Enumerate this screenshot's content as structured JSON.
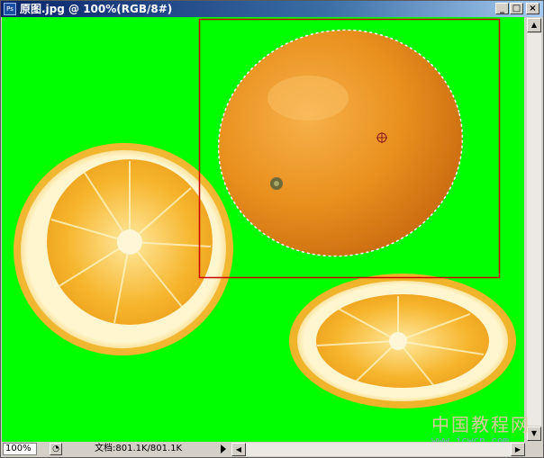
{
  "window": {
    "title": "原图.jpg @ 100%(RGB/8#)",
    "app_icon_label": "Ps",
    "buttons": {
      "minimize": "_",
      "maximize": "□",
      "close": "×"
    }
  },
  "canvas": {
    "background_color": "#00ff00",
    "selection_box_color": "#cc0000",
    "objects": [
      "orange-slice-left",
      "whole-orange",
      "orange-slice-bottom"
    ]
  },
  "status": {
    "zoom": "100%",
    "doc_info": "文档:801.1K/801.1K"
  },
  "watermark": {
    "text": "中国教程网",
    "url": "www.jcwcn.com"
  }
}
